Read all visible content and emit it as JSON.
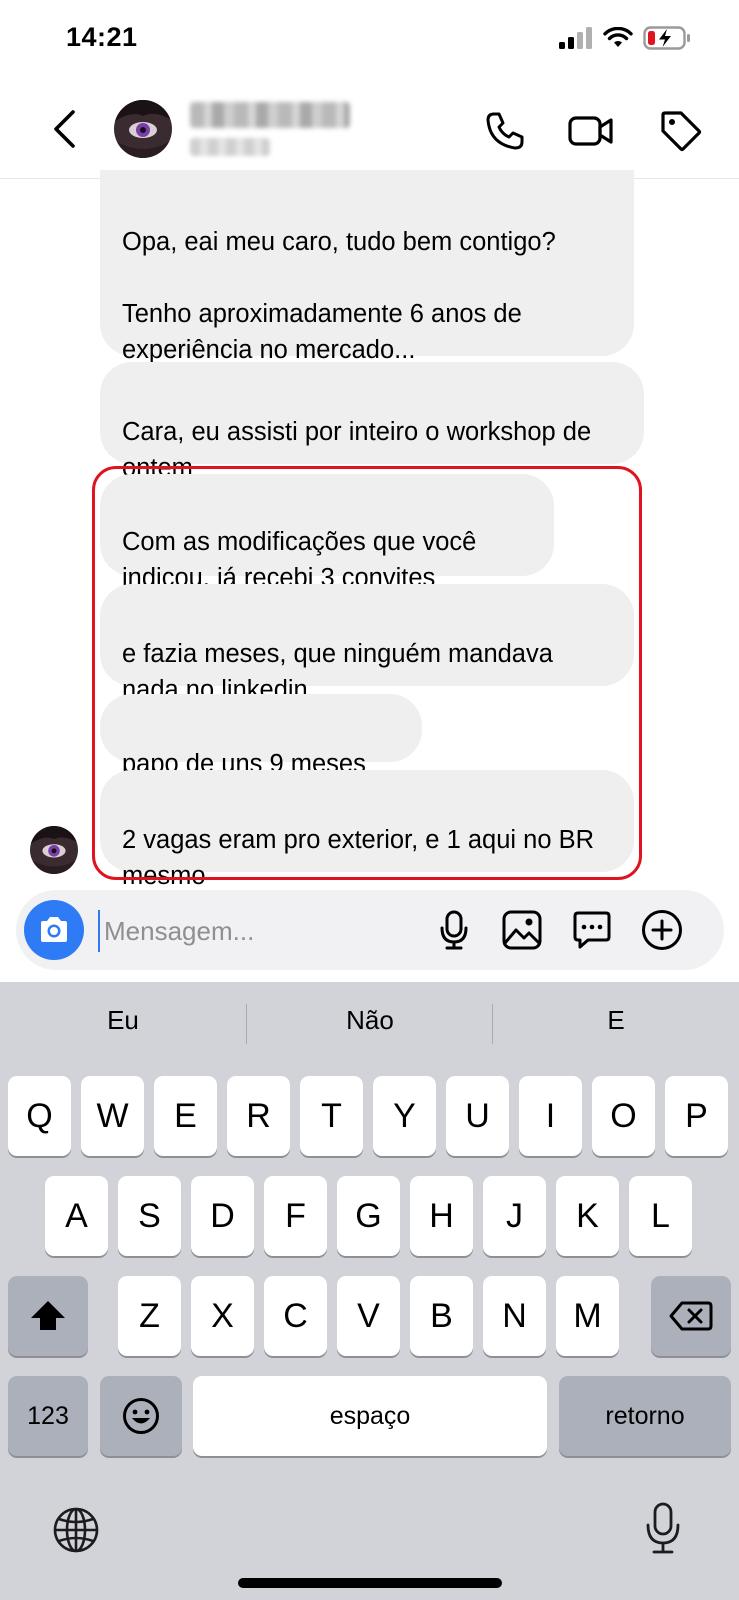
{
  "status_bar": {
    "time": "14:21",
    "icons": [
      "cellular-signal-icon",
      "wifi-icon",
      "battery-charging-icon"
    ],
    "battery_color": "#e0141e"
  },
  "header": {
    "icons": [
      "back-chevron-icon",
      "phone-icon",
      "video-camera-icon",
      "tag-icon"
    ]
  },
  "messages": [
    {
      "text": "Opa, eai meu caro, tudo bem contigo?\n\nTenho aproximadamente 6 anos de experiência no mercado..."
    },
    {
      "text": "Cara, eu assisti por inteiro o workshop de ontem"
    },
    {
      "text": "Com as modificações que você indicou, já recebi 3 convites"
    },
    {
      "text": "e fazia meses, que ninguém mandava nada no linkedin"
    },
    {
      "text": "papo de uns 9 meses"
    },
    {
      "text": "2 vagas eram pro exterior, e 1 aqui no BR mesmo"
    }
  ],
  "highlight_color": "#e0141e",
  "composer": {
    "placeholder": "Mensagem...",
    "icons": [
      "camera-icon",
      "microphone-icon",
      "image-icon",
      "sticker-chat-icon",
      "plus-circle-icon"
    ],
    "camera_color": "#2f7bf5"
  },
  "keyboard": {
    "suggestions": [
      "Eu",
      "Não",
      "E"
    ],
    "row1": [
      "Q",
      "W",
      "E",
      "R",
      "T",
      "Y",
      "U",
      "I",
      "O",
      "P"
    ],
    "row2": [
      "A",
      "S",
      "D",
      "F",
      "G",
      "H",
      "J",
      "K",
      "L"
    ],
    "row3": [
      "Z",
      "X",
      "C",
      "V",
      "B",
      "N",
      "M"
    ],
    "numbers_label": "123",
    "space_label": "espaço",
    "return_label": "retorno",
    "icons": [
      "shift-icon",
      "backspace-icon",
      "emoji-icon",
      "globe-icon",
      "dictation-mic-icon"
    ]
  }
}
